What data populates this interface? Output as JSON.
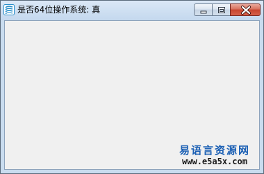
{
  "window": {
    "title": "是否64位操作系统: 真",
    "icon": "app-logo-icon",
    "buttons": [
      "minimize-icon",
      "maximize-icon",
      "close-icon"
    ]
  },
  "watermark": {
    "name": "易语言资源网",
    "url": "www.e5a5x.com"
  },
  "colors": {
    "titlebar": "#cfe0f2",
    "client_bg": "#f0f0f0",
    "close_button": "#c7452f",
    "watermark_blue": "#1a5fb4"
  }
}
